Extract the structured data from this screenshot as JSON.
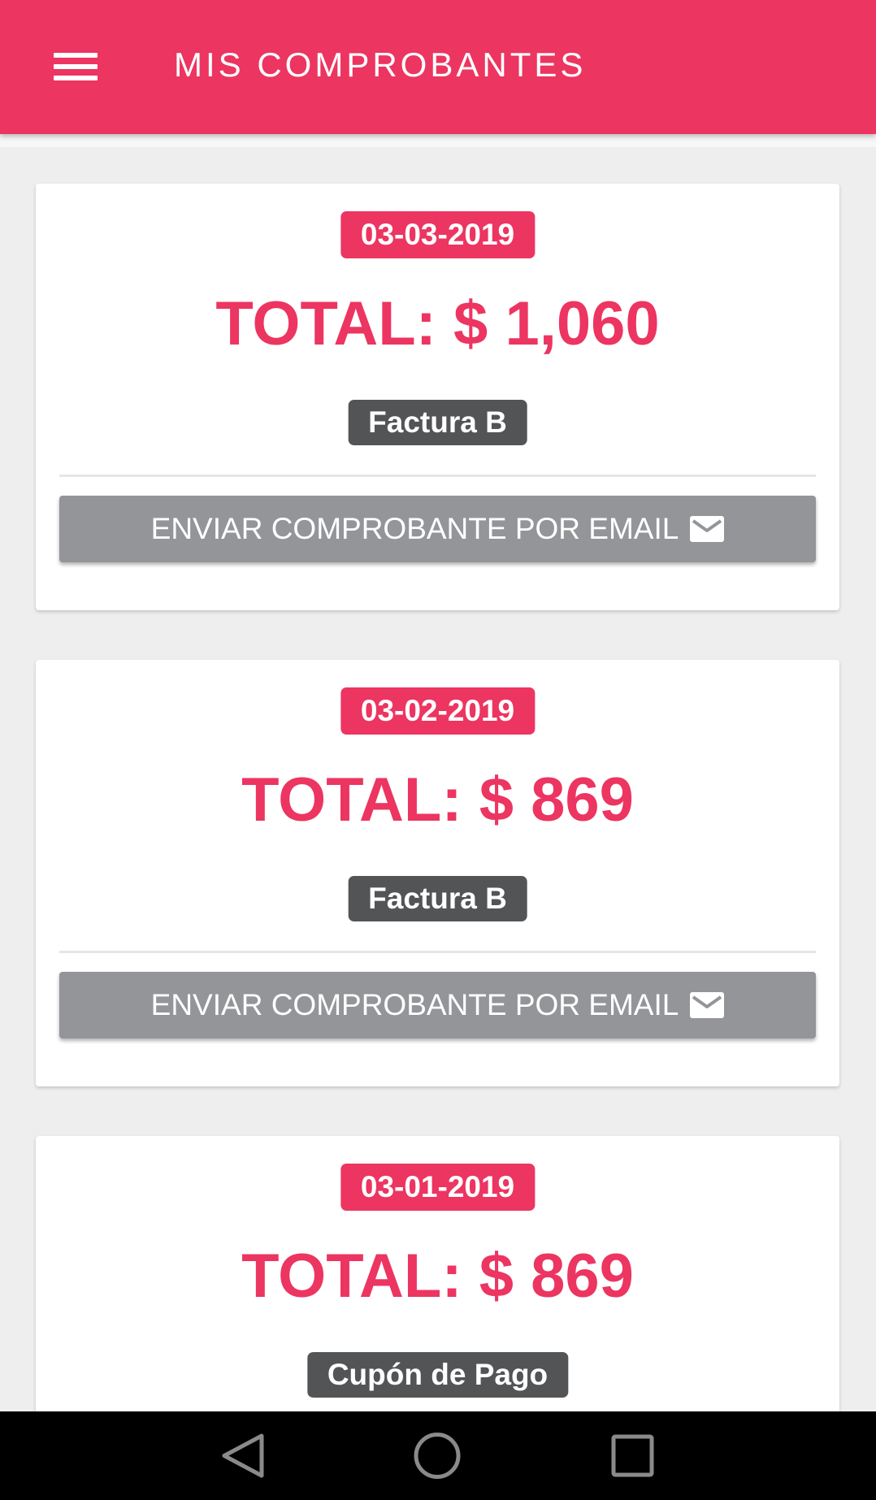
{
  "header": {
    "title": "MIS COMPROBANTES",
    "menu_icon": "hamburger-menu-icon"
  },
  "receipts": [
    {
      "date": "03-03-2019",
      "total": "TOTAL: $ 1,060",
      "type": "Factura B",
      "email_button": "ENVIAR COMPROBANTE POR EMAIL",
      "email_icon": "mail-icon"
    },
    {
      "date": "03-02-2019",
      "total": "TOTAL: $ 869",
      "type": "Factura B",
      "email_button": "ENVIAR COMPROBANTE POR EMAIL",
      "email_icon": "mail-icon"
    },
    {
      "date": "03-01-2019",
      "total": "TOTAL: $ 869",
      "type": "Cupón de Pago"
    }
  ],
  "navbar": {
    "icons": [
      "back-triangle-icon",
      "home-circle-icon",
      "recents-square-icon"
    ]
  },
  "colors": {
    "accent": "#ec3561",
    "badge_dark": "#535456",
    "button_gray": "#939598",
    "background": "#eeeeee"
  }
}
